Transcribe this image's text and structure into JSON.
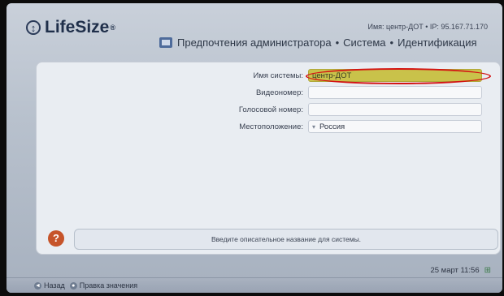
{
  "app": {
    "logo_text": "LifeSize",
    "logo_reg": "®"
  },
  "header": {
    "system_info": "Имя: центр-ДОТ • IP: 95.167.71.170",
    "breadcrumb": [
      "Предпочтения администратора",
      "Система",
      "Идентификация"
    ],
    "separator": "•"
  },
  "form": {
    "fields": [
      {
        "label": "Имя системы:",
        "value": "центр-ДОТ"
      },
      {
        "label": "Видеономер:",
        "value": ""
      },
      {
        "label": "Голосовой номер:",
        "value": ""
      },
      {
        "label": "Местоположение:",
        "value": "Россия"
      }
    ]
  },
  "help": {
    "text": "Введите описательное название для системы."
  },
  "status": {
    "datetime": "25 март  11:56"
  },
  "footer": {
    "back_label": "Назад",
    "edit_label": "Правка значения"
  },
  "colors": {
    "active_field": "#c9c24a",
    "highlight_ring": "#d41313",
    "help_icon": "#c6542a"
  }
}
